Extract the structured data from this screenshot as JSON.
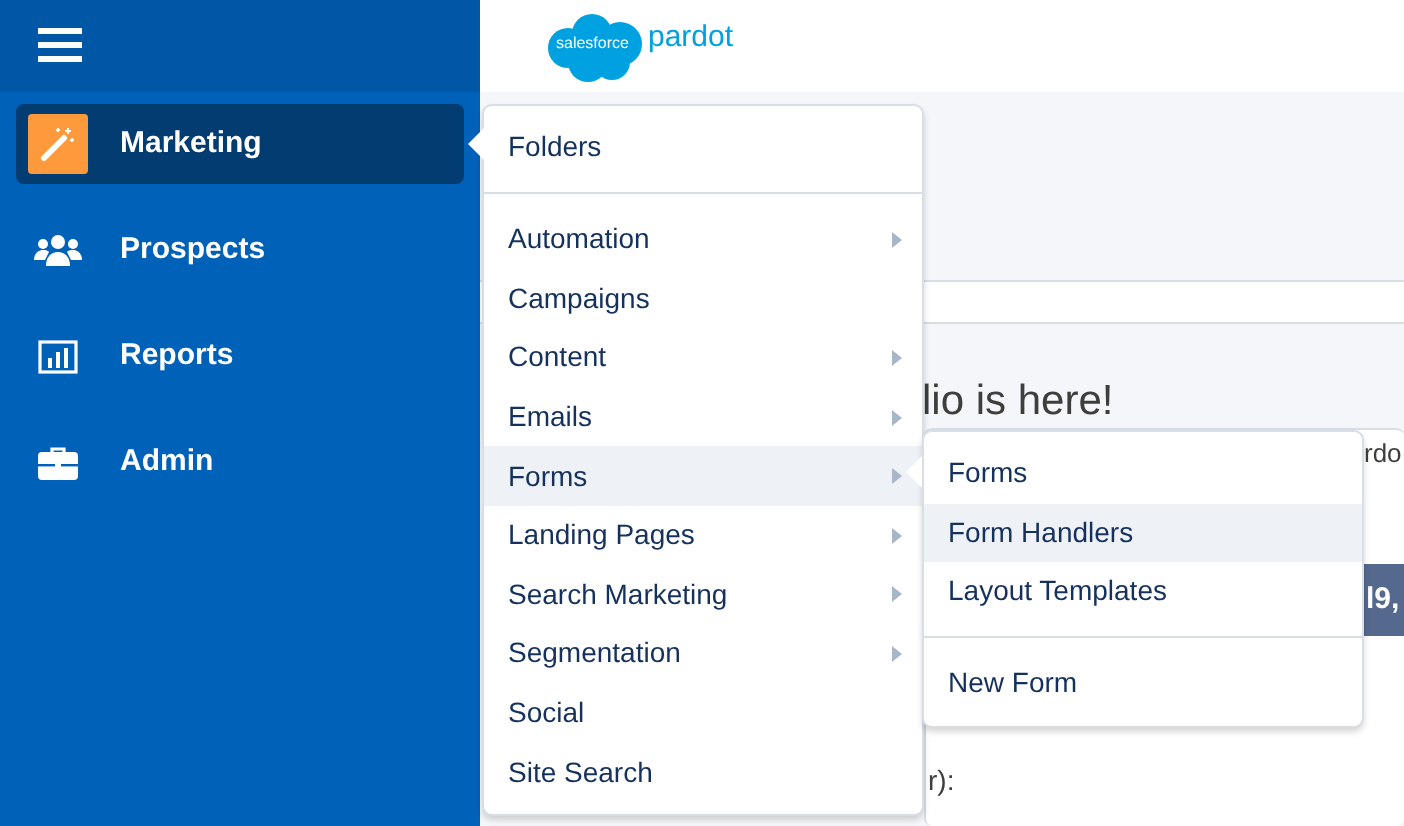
{
  "sidebar": {
    "items": [
      {
        "label": "Marketing",
        "kind": "wand",
        "selected": true
      },
      {
        "label": "Prospects",
        "kind": "people",
        "selected": false
      },
      {
        "label": "Reports",
        "kind": "chart",
        "selected": false
      },
      {
        "label": "Admin",
        "kind": "briefcase",
        "selected": false
      }
    ]
  },
  "header": {
    "logo_badge": "salesforce",
    "logo_text": "pardot"
  },
  "background": {
    "heading": "lio is here!",
    "fragment_1": "rdo",
    "banner": "l9,",
    "fragment_2": "r):"
  },
  "menu": {
    "items": [
      {
        "label": "Folders",
        "has_submenu": false,
        "highlighted": false,
        "divider_after": true
      },
      {
        "label": "Automation",
        "has_submenu": true,
        "highlighted": false,
        "divider_after": false
      },
      {
        "label": "Campaigns",
        "has_submenu": false,
        "highlighted": false,
        "divider_after": false
      },
      {
        "label": "Content",
        "has_submenu": true,
        "highlighted": false,
        "divider_after": false
      },
      {
        "label": "Emails",
        "has_submenu": true,
        "highlighted": false,
        "divider_after": false
      },
      {
        "label": "Forms",
        "has_submenu": true,
        "highlighted": true,
        "divider_after": false
      },
      {
        "label": "Landing Pages",
        "has_submenu": true,
        "highlighted": false,
        "divider_after": false
      },
      {
        "label": "Search Marketing",
        "has_submenu": true,
        "highlighted": false,
        "divider_after": false
      },
      {
        "label": "Segmentation",
        "has_submenu": true,
        "highlighted": false,
        "divider_after": false
      },
      {
        "label": "Social",
        "has_submenu": false,
        "highlighted": false,
        "divider_after": false
      },
      {
        "label": "Site Search",
        "has_submenu": false,
        "highlighted": false,
        "divider_after": false
      }
    ]
  },
  "submenu": {
    "items": [
      {
        "label": "Forms",
        "highlighted": false,
        "divider_after": false
      },
      {
        "label": "Form Handlers",
        "highlighted": true,
        "divider_after": false
      },
      {
        "label": "Layout Templates",
        "highlighted": false,
        "divider_after": true
      },
      {
        "label": "New Form",
        "highlighted": false,
        "divider_after": false
      }
    ]
  }
}
